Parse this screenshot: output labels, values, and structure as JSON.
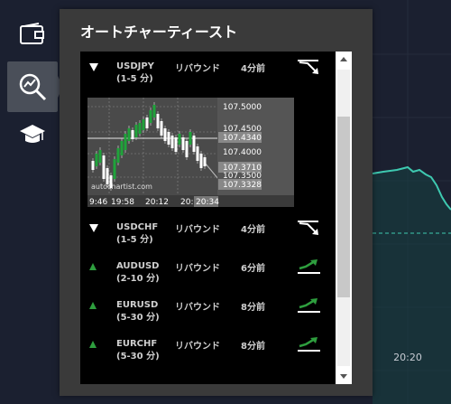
{
  "panel": {
    "title": "オートチャーティースト"
  },
  "sidebar": {
    "icons": [
      "wallet-icon",
      "analysis-icon",
      "education-icon"
    ]
  },
  "signals": [
    {
      "pair": "USDJPY",
      "period": "(1-5 分)",
      "pattern": "リバウンド",
      "time": "4分前",
      "direction": "down",
      "signal_icon": "downtrend-icon"
    },
    {
      "pair": "USDCHF",
      "period": "(1-5 分)",
      "pattern": "リバウンド",
      "time": "4分前",
      "direction": "down",
      "signal_icon": "downtrend-icon"
    },
    {
      "pair": "AUDUSD",
      "period": "(2-10 分)",
      "pattern": "リバウンド",
      "time": "6分前",
      "direction": "up",
      "signal_icon": "uptrend-icon"
    },
    {
      "pair": "EURUSD",
      "period": "(5-30 分)",
      "pattern": "リバウンド",
      "time": "8分前",
      "direction": "up",
      "signal_icon": "uptrend-icon"
    },
    {
      "pair": "EURCHF",
      "period": "(5-30 分)",
      "pattern": "リバウンド",
      "time": "8分前",
      "direction": "up",
      "signal_icon": "uptrend-icon"
    }
  ],
  "mini_chart": {
    "watermark": "autochartist.com",
    "price_labels": [
      "107.5000",
      "107.4500",
      "107.4340",
      "107.4000",
      "107.3710",
      "107.3500",
      "107.3328"
    ],
    "time_labels": [
      "9:46",
      "19:58",
      "20:12",
      "20:",
      "20:34"
    ]
  },
  "background_chart": {
    "time_label": "20:20",
    "line_color": "#3ec9b0"
  },
  "colors": {
    "up": "#2e9e3e",
    "down": "#ffffff",
    "panel": "#3a3a3a"
  }
}
